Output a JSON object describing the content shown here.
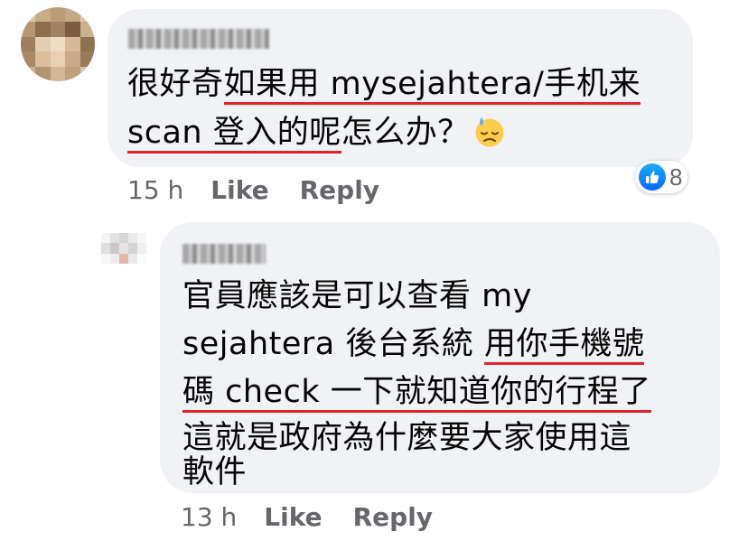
{
  "comments": [
    {
      "line1": {
        "plain": "很好奇",
        "underlined": "如果用 mysejahtera/手机来"
      },
      "line2": {
        "underlined": "scan 登入的呢",
        "plain": "怎么办？"
      },
      "emoji": "downcast-face-with-sweat-icon",
      "time": "15 h",
      "like_label": "Like",
      "reply_label": "Reply",
      "reaction": {
        "icon": "like-icon",
        "count": "8",
        "color": "#0866ff"
      }
    },
    {
      "line1": {
        "plain": "官員應該是可以查看 my"
      },
      "line2": {
        "plain": "sejahtera 後台系統 ",
        "underlined": "用你手機號"
      },
      "line3": {
        "underlined": "碼 check 一下就知道你的行程了"
      },
      "line4": {
        "plain": "這就是政府為什麼要大家使用這"
      },
      "line5": {
        "plain": "軟件"
      },
      "time": "13 h",
      "like_label": "Like",
      "reply_label": "Reply"
    }
  ],
  "colors": {
    "bubble": "#f0f2f5",
    "meta_text": "#65676b",
    "underline": "#e0242a"
  }
}
